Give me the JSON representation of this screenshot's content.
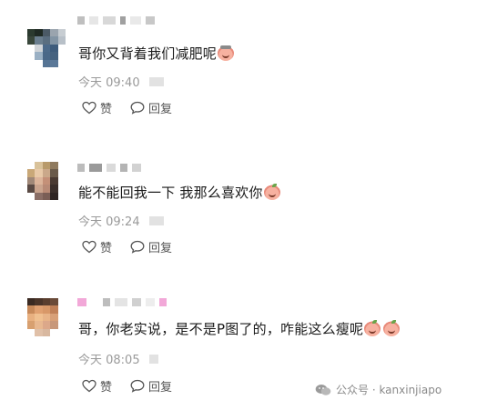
{
  "comments": [
    {
      "text": "哥你又背着我们减肥呢",
      "emoji": "tired-face-icon",
      "time": "今天 09:40",
      "like_label": "赞",
      "reply_label": "回复"
    },
    {
      "text": "能不能回我一下 我那么喜欢你",
      "emoji": "peach-face-icon",
      "time": "今天 09:24",
      "like_label": "赞",
      "reply_label": "回复"
    },
    {
      "text": "哥，你老实说，是不是P图了的，咋能这么瘦呢",
      "emoji": "peach-face-icon",
      "time": "今天 08:05",
      "like_label": "赞",
      "reply_label": "回复"
    }
  ],
  "watermark": {
    "text": "公众号 · kanxinjiapo"
  }
}
